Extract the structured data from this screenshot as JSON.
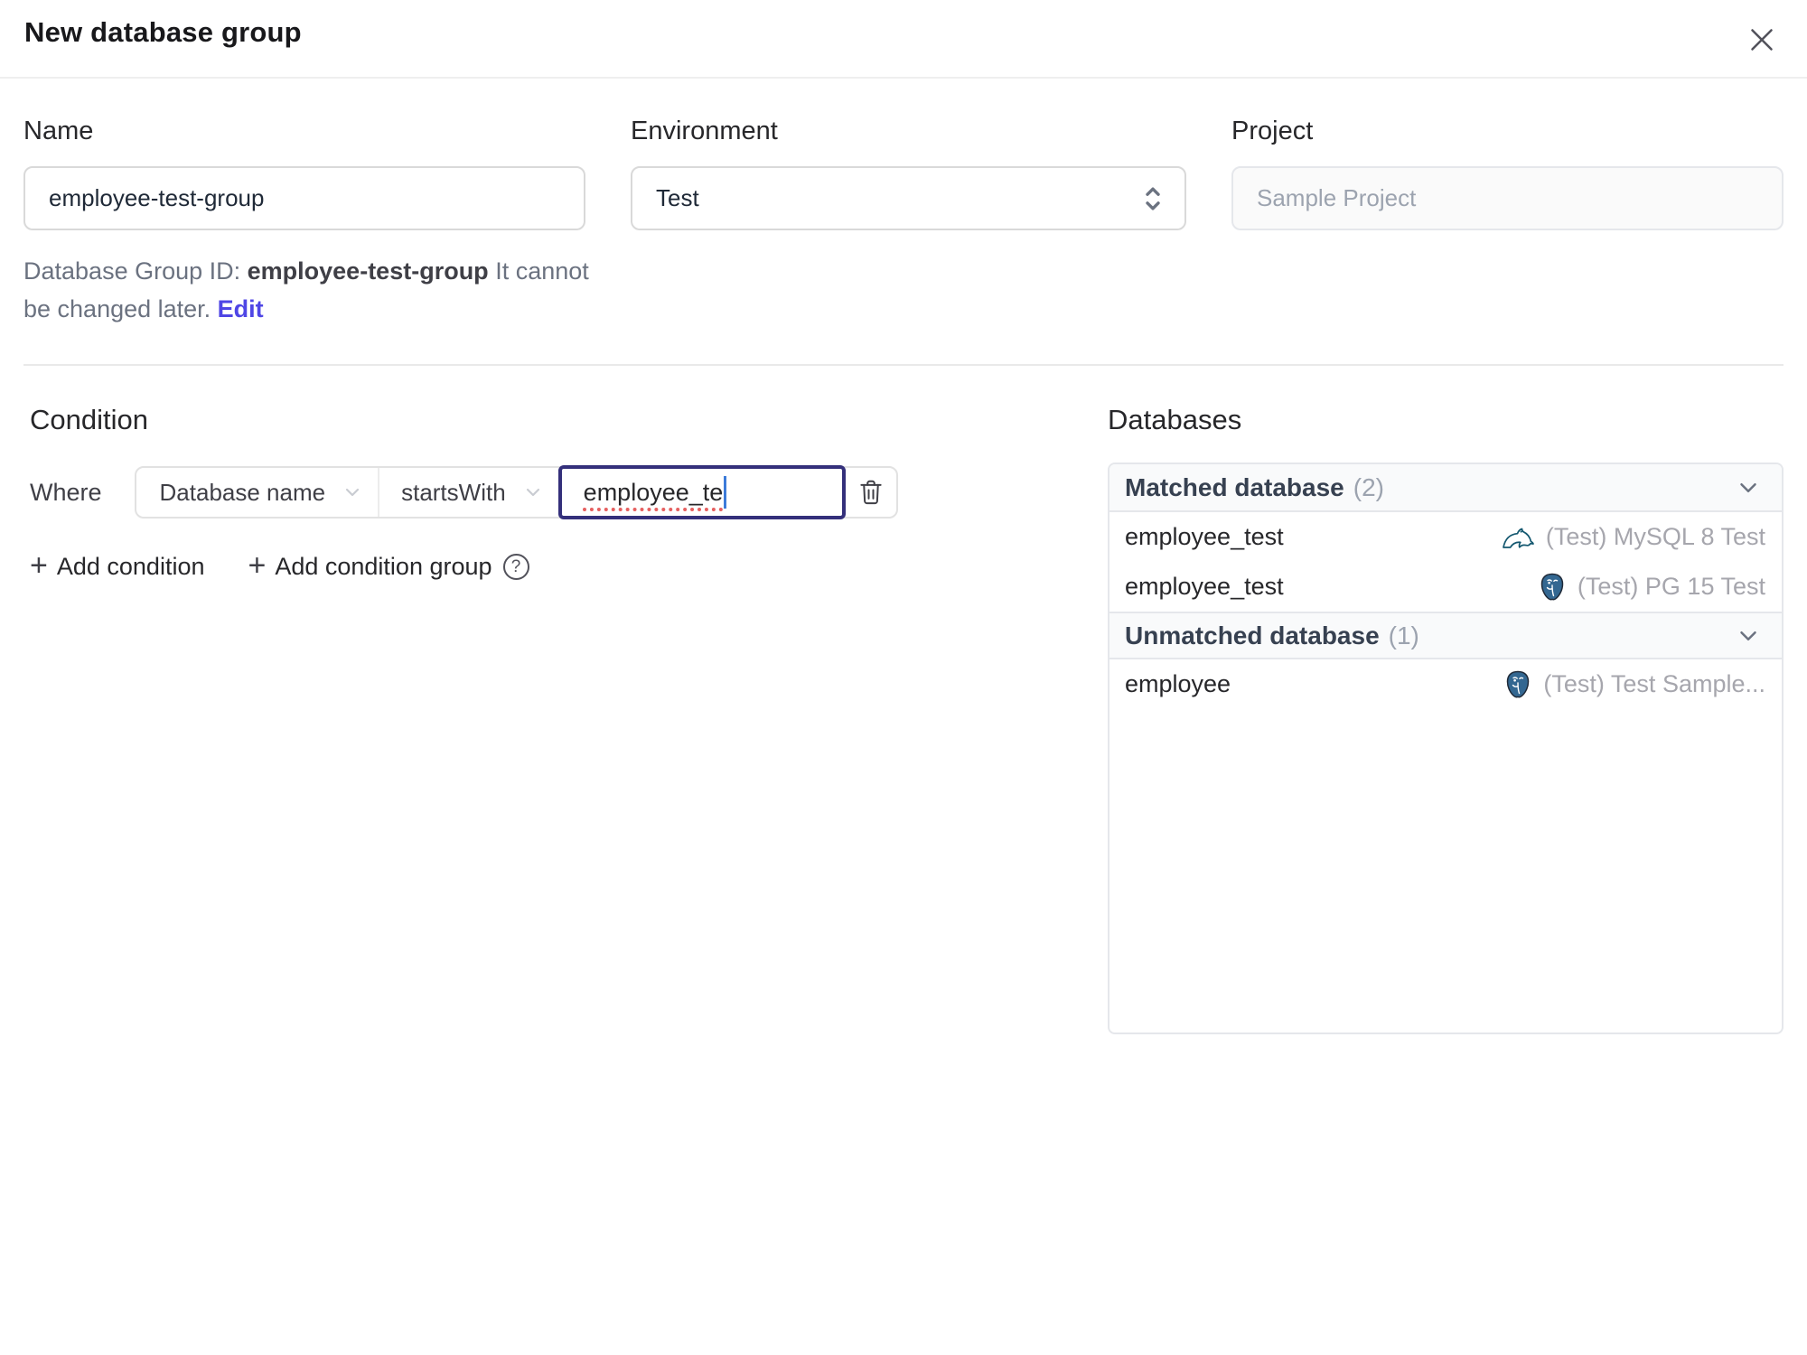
{
  "dialog": {
    "title": "New database group"
  },
  "form": {
    "name": {
      "label": "Name",
      "value": "employee-test-group"
    },
    "environment": {
      "label": "Environment",
      "value": "Test"
    },
    "project": {
      "label": "Project",
      "value": "Sample Project"
    },
    "group_id_note": {
      "prefix": "Database Group ID: ",
      "id": "employee-test-group",
      "suffix": " It cannot be changed later. ",
      "edit_label": "Edit"
    }
  },
  "condition": {
    "heading": "Condition",
    "where_label": "Where",
    "factor": "Database name",
    "operator": "startsWith",
    "value": "employee_te",
    "add_condition_label": "Add condition",
    "add_condition_group_label": "Add condition group",
    "help_glyph": "?"
  },
  "databases": {
    "heading": "Databases",
    "sections": [
      {
        "title": "Matched database",
        "count": "(2)",
        "rows": [
          {
            "name": "employee_test",
            "engine": "mysql",
            "instance": "(Test) MySQL 8 Test"
          },
          {
            "name": "employee_test",
            "engine": "postgresql",
            "instance": "(Test) PG 15 Test"
          }
        ]
      },
      {
        "title": "Unmatched database",
        "count": "(1)",
        "rows": [
          {
            "name": "employee",
            "engine": "postgresql",
            "instance": "(Test) Test Sample..."
          }
        ]
      }
    ]
  },
  "colors": {
    "accent_link": "#4f46e5",
    "focus_border": "#34307b",
    "spellcheck_underline": "#e66060",
    "mysql_icon": "#13576f",
    "postgres_icon": "#336791",
    "section_header_bg": "#f9fafb",
    "muted_text": "#9ca3af"
  }
}
